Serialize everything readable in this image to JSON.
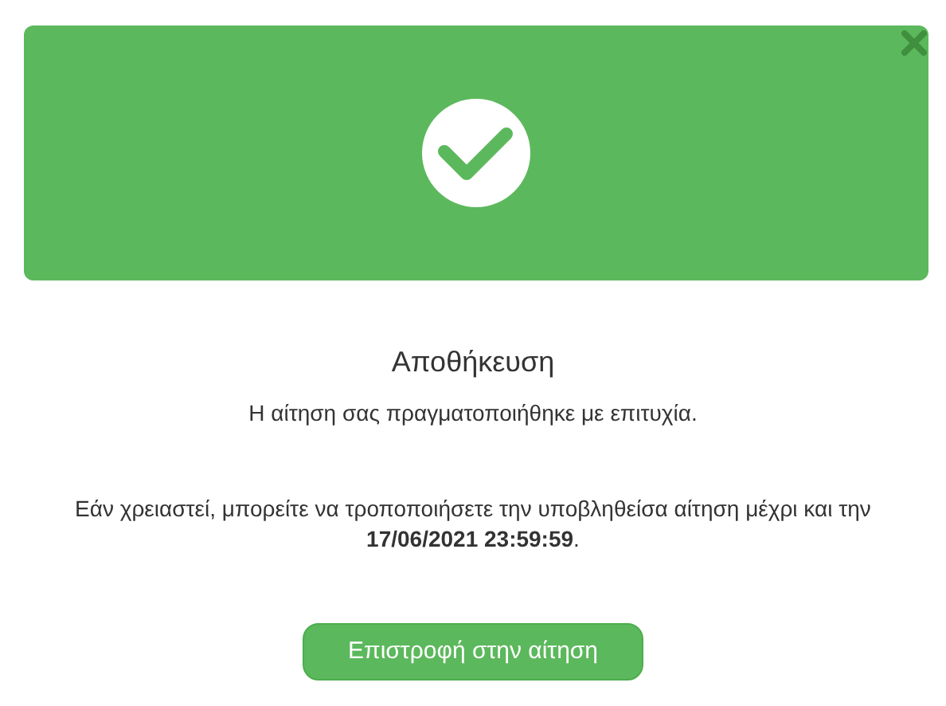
{
  "dialog": {
    "title": "Αποθήκευση",
    "message": "Η αίτηση σας πραγματοποιήθηκε με επιτυχία.",
    "note": "Εάν χρειαστεί, μπορείτε να τροποποιήσετε την υποβληθείσα αίτηση μέχρι και την **17/06/2021 23:59:59**.",
    "button": "Επιστροφή στην αίτηση"
  }
}
